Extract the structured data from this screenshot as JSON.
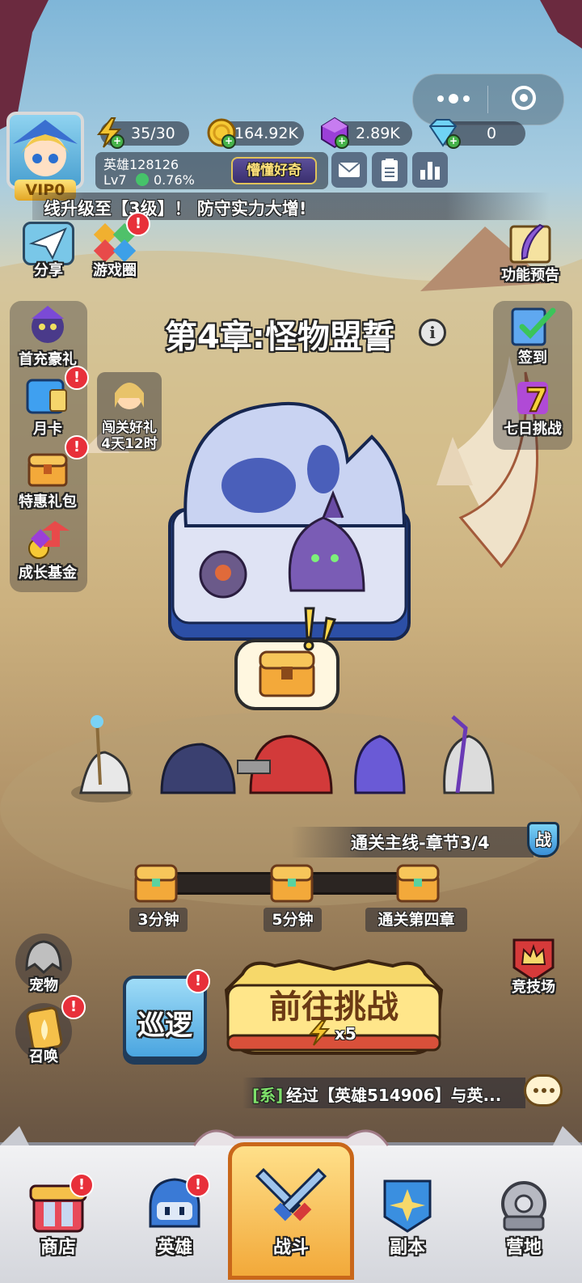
{
  "resources": {
    "energy": "35/30",
    "gold": "164.92K",
    "gems": "2.89K",
    "diamonds": "0"
  },
  "player": {
    "name": "英雄128126",
    "level": "Lv7",
    "exp": "0.76%",
    "vip": "VIP0",
    "title_badge": "懵懂好奇"
  },
  "ticker": "线升级至【3级】！ 防守实力大增!",
  "left_top": {
    "share": "分享",
    "game_circle": "游戏圈"
  },
  "right_top": {
    "preview": "功能预告"
  },
  "chapter_title": "第4章:怪物盟誓",
  "left_menu": {
    "first_charge": "首充豪礼",
    "month_card": "月卡",
    "special_pack": "特惠礼包",
    "growth_fund": "成长基金"
  },
  "clear_gift": {
    "label": "闯关好礼",
    "timer": "4天12时"
  },
  "right_menu": {
    "signin": "签到",
    "seven_day": "七日挑战"
  },
  "progress": {
    "label": "通关主线-章节3/4",
    "battle_icon": "战",
    "milestones": [
      "3分钟",
      "5分钟",
      "通关第四章"
    ]
  },
  "pet": "宠物",
  "summon": "召唤",
  "patrol": "巡逻",
  "challenge": {
    "label": "前往挑战",
    "cost": "x5"
  },
  "arena": "竞技场",
  "chat": {
    "prefix": "[系]",
    "message": "经过【英雄514906】与英..."
  },
  "nav": [
    "商店",
    "英雄",
    "战斗",
    "副本",
    "营地"
  ],
  "badge_mark": "!"
}
